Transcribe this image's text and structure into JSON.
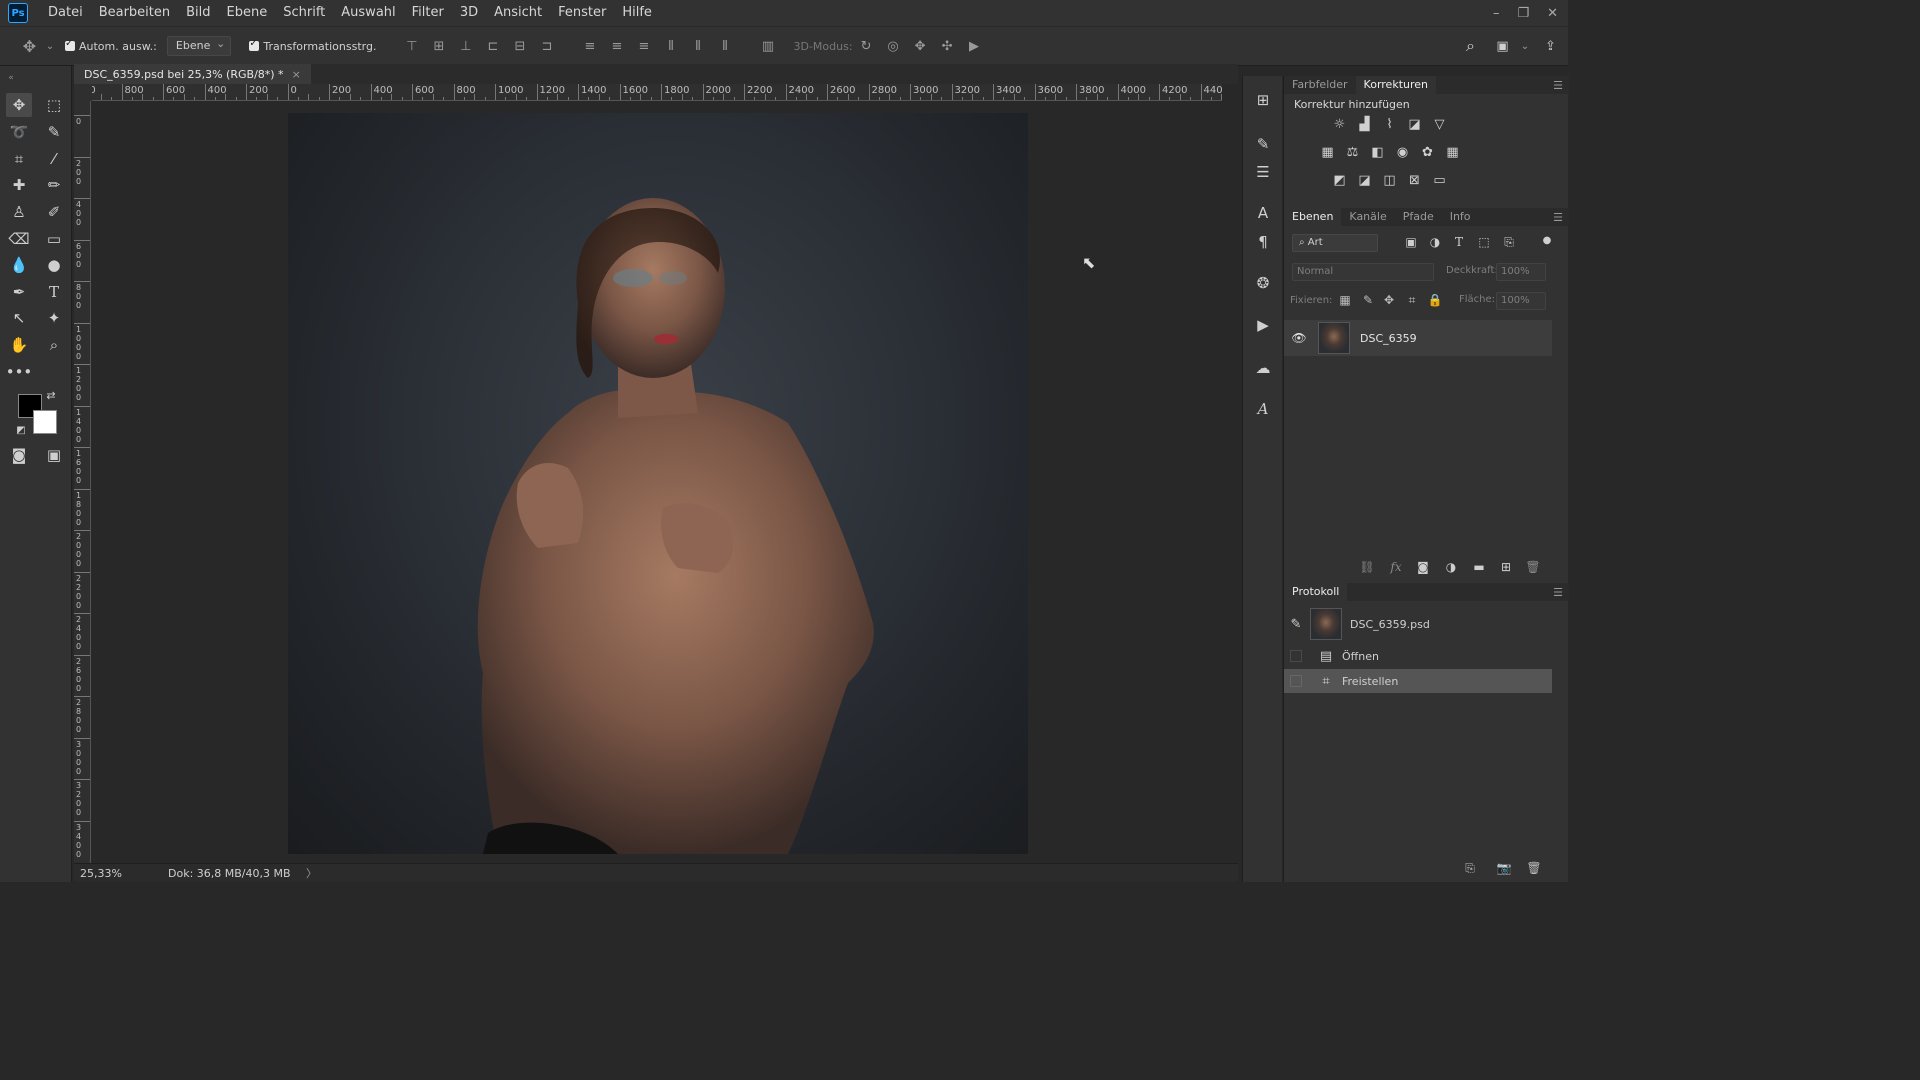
{
  "app": {
    "logo": "Ps"
  },
  "menu": [
    "Datei",
    "Bearbeiten",
    "Bild",
    "Ebene",
    "Schrift",
    "Auswahl",
    "Filter",
    "3D",
    "Ansicht",
    "Fenster",
    "Hilfe"
  ],
  "window_controls": {
    "minimize": "–",
    "restore": "❐",
    "close": "✕"
  },
  "options": {
    "auto_select_label": "Autom. ausw.:",
    "auto_select_value": "Ebene",
    "transform_label": "Transformationsstrg.",
    "mode_3d_label": "3D-Modus:"
  },
  "document": {
    "tab_title": "DSC_6359.psd bei 25,3% (RGB/8*) *",
    "close_glyph": "×"
  },
  "ruler_top": [
    "00",
    "800",
    "600",
    "400",
    "200",
    "0",
    "200",
    "400",
    "600",
    "800",
    "1000",
    "1200",
    "1400",
    "1600",
    "1800",
    "2000",
    "2200",
    "2400",
    "2600",
    "2800",
    "3000",
    "3200",
    "3400",
    "3600",
    "3800",
    "4000",
    "4200",
    "4400"
  ],
  "ruler_left": [
    "0",
    "2\n0\n0",
    "4\n0\n0",
    "6\n0\n0",
    "8\n0\n0",
    "1\n0\n0\n0",
    "1\n2\n0\n0",
    "1\n4\n0\n0",
    "1\n6\n0\n0",
    "1\n8\n0\n0",
    "2\n0\n0\n0",
    "2\n2\n0\n0",
    "2\n4\n0\n0",
    "2\n6\n0\n0",
    "2\n8\n0\n0",
    "3\n0\n0\n0",
    "3\n2\n0\n0",
    "3\n4\n0\n0"
  ],
  "status": {
    "zoom": "25,33%",
    "doc_size": "Dok: 36,8 MB/40,3 MB",
    "arrow": "〉"
  },
  "panels": {
    "color_tabs": [
      "Farbfelder",
      "Korrekturen"
    ],
    "adjustments_title": "Korrektur hinzufügen",
    "layer_tabs": [
      "Ebenen",
      "Kanäle",
      "Pfade",
      "Info"
    ],
    "layer_filter": "Art",
    "blend_mode": "Normal",
    "opacity_label": "Deckkraft:",
    "opacity_value": "100%",
    "lock_label": "Fixieren:",
    "fill_label": "Fläche:",
    "fill_value": "100%",
    "layer_name": "DSC_6359",
    "history_title": "Protokoll",
    "history_snapshot": "DSC_6359.psd",
    "history_items": [
      "Öffnen",
      "Freistellen"
    ]
  }
}
